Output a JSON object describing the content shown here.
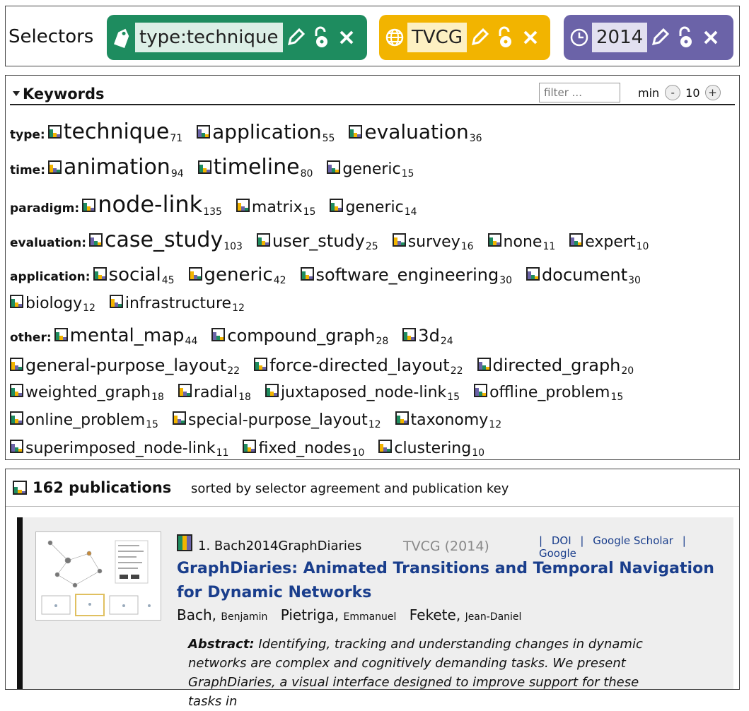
{
  "selectors": {
    "label": "Selectors",
    "chips": [
      {
        "kind": "tag",
        "value": "type:technique",
        "color": "#1e8c5f"
      },
      {
        "kind": "globe",
        "value": "TVCG",
        "color": "#f2b400"
      },
      {
        "kind": "clock",
        "value": "2014",
        "color": "#6b63a8"
      }
    ]
  },
  "keywords": {
    "title": "Keywords",
    "filter_placeholder": "filter ...",
    "min_label": "min",
    "min_value": "10",
    "minus": "-",
    "plus": "+",
    "rows": [
      {
        "category": "type:",
        "items": [
          [
            "technique",
            "71",
            30
          ],
          [
            "application",
            "55",
            28
          ],
          [
            "evaluation",
            "36",
            28
          ]
        ]
      },
      {
        "category": "time:",
        "items": [
          [
            "animation",
            "94",
            30
          ],
          [
            "timeline",
            "80",
            30
          ],
          [
            "generic",
            "15",
            22
          ]
        ]
      },
      {
        "category": "paradigm:",
        "items": [
          [
            "node-link",
            "135",
            32
          ],
          [
            "matrix",
            "15",
            22
          ],
          [
            "generic",
            "14",
            22
          ]
        ]
      },
      {
        "category": "evaluation:",
        "items": [
          [
            "case_study",
            "103",
            30
          ],
          [
            "user_study",
            "25",
            24
          ],
          [
            "survey",
            "16",
            22
          ],
          [
            "none",
            "11",
            22
          ],
          [
            "expert",
            "10",
            22
          ]
        ]
      },
      {
        "category": "application:",
        "items": [
          [
            "social",
            "45",
            26
          ],
          [
            "generic",
            "42",
            26
          ],
          [
            "software_engineering",
            "30",
            24
          ],
          [
            "document",
            "30",
            24
          ]
        ]
      },
      {
        "category": "",
        "items": [
          [
            "biology",
            "12",
            22
          ],
          [
            "infrastructure",
            "12",
            22
          ]
        ]
      },
      {
        "category": "other:",
        "items": [
          [
            "mental_map",
            "44",
            26
          ],
          [
            "compound_graph",
            "28",
            24
          ],
          [
            "3d",
            "24",
            24
          ]
        ]
      },
      {
        "category": "",
        "items": [
          [
            "general-purpose_layout",
            "22",
            24
          ],
          [
            "force-directed_layout",
            "22",
            24
          ],
          [
            "directed_graph",
            "20",
            24
          ]
        ]
      },
      {
        "category": "",
        "items": [
          [
            "weighted_graph",
            "18",
            22
          ],
          [
            "radial",
            "18",
            22
          ],
          [
            "juxtaposed_node-link",
            "15",
            22
          ],
          [
            "offline_problem",
            "15",
            22
          ]
        ]
      },
      {
        "category": "",
        "items": [
          [
            "online_problem",
            "15",
            22
          ],
          [
            "special-purpose_layout",
            "12",
            22
          ],
          [
            "taxonomy",
            "12",
            22
          ]
        ]
      },
      {
        "category": "",
        "items": [
          [
            "superimposed_node-link",
            "11",
            22
          ],
          [
            "fixed_nodes",
            "10",
            22
          ],
          [
            "clustering",
            "10",
            22
          ]
        ]
      }
    ]
  },
  "publications": {
    "count_label": "162 publications",
    "sort_label": "sorted by selector agreement and publication key",
    "entry": {
      "key": "1. Bach2014GraphDiaries",
      "venue": "TVCG",
      "year": "(2014)",
      "links": [
        "|",
        "DOI",
        "|",
        "Google Scholar",
        "|",
        "Google"
      ],
      "title": "GraphDiaries: Animated Transitions and Temporal Navigation for Dynamic Networks",
      "authors": [
        {
          "last": "Bach,",
          "first": "Benjamin"
        },
        {
          "last": "Pietriga,",
          "first": "Emmanuel"
        },
        {
          "last": "Fekete,",
          "first": "Jean-Daniel"
        }
      ],
      "abstract_label": "Abstract:",
      "abstract": " Identifying, tracking and understanding changes in dynamic networks are complex and cognitively demanding tasks. We present GraphDiaries, a visual interface designed to improve support for these tasks in"
    }
  },
  "colors": {
    "green": "#1e8c5f",
    "yellow": "#f2b400",
    "purple": "#6b63a8",
    "link": "#1a3e8c"
  }
}
